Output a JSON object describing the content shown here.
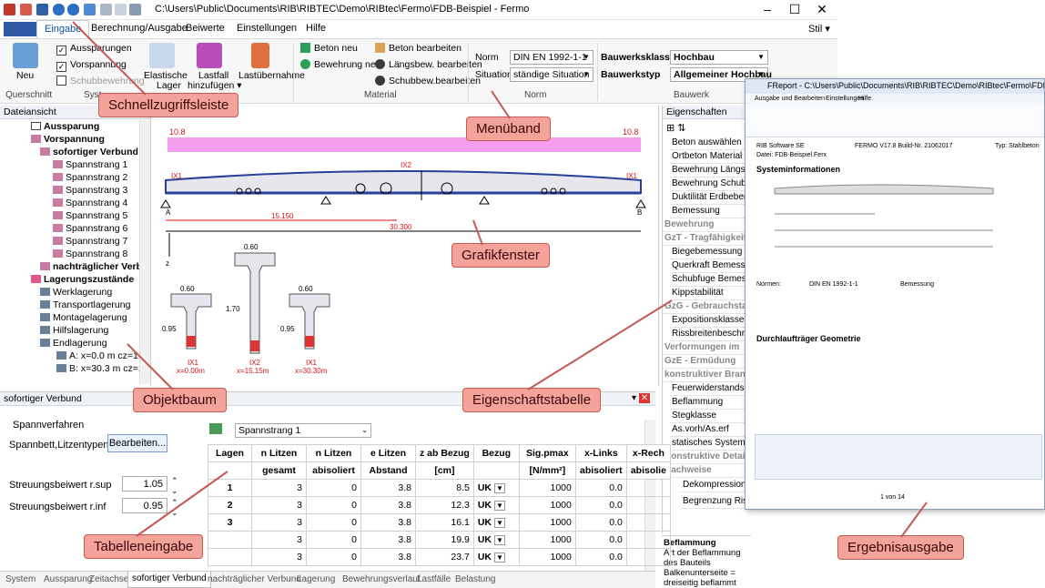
{
  "titlebar": {
    "path": "C:\\Users\\Public\\Documents\\RIB\\RIBTEC\\Demo\\RIBtec\\Fermo\\FDB-Beispiel - Fermo",
    "minimize": "–",
    "maximize": "☐",
    "close": "✕"
  },
  "tabs": {
    "t1": "Eingabe",
    "t2": "Berechnung/Ausgabe",
    "t3": "Beiwerte",
    "t4": "Einstellungen",
    "t5": "Hilfe",
    "style": "Stil ▾"
  },
  "ribbon": {
    "neu": "Neu",
    "aussp": "Aussparungen",
    "vorsp": "Vorspannung",
    "schubbew": "Schubbewehrung",
    "elast": "Elastische",
    "lager": "Lager",
    "lastfall": "Lastfall",
    "hinzu": "hinzufügen ▾",
    "lastuber": "Lastübernahme",
    "betonneu": "Beton neu",
    "bewneu": "Bewehrung neu",
    "betonbe": "Beton bearbeiten",
    "laengs": "Längsbew. bearbeiten",
    "schubbe": "Schubbew.bearbeiten",
    "norm_label": "Norm",
    "norm_value": "DIN EN 1992-1-1",
    "sit_label": "Situation",
    "sit_value": "ständige Situation",
    "bwk_label": "Bauwerksklasse",
    "bwk_value": "Hochbau",
    "bwt_label": "Bauwerkstyp",
    "bwt_value": "Allgemeiner Hochbau",
    "g_querschnitt": "Querschnitt",
    "g_system": "Syst",
    "g_material": "Material",
    "g_norm": "Norm",
    "g_bauwerk": "Bauwerk"
  },
  "tree": {
    "head": "Dateiansicht",
    "items": [
      "Aussparung",
      "Vorspannung",
      "sofortiger Verbund",
      "Spannstrang 1",
      "Spannstrang 2",
      "Spannstrang 3",
      "Spannstrang 4",
      "Spannstrang 5",
      "Spannstrang 6",
      "Spannstrang 7",
      "Spannstrang 8",
      "nachträglicher Verbur",
      "Lagerungszustände",
      "Werklagerung",
      "Transportlagerung",
      "Montagelagerung",
      "Hilfslagerung",
      "Endlagerung",
      "A: x=0.0 m  cz=1.0 r",
      "B: x=30.3 m  cz=1.0"
    ]
  },
  "graphics": {
    "left10": "10.8",
    "right10": "10.8",
    "ix1": "IX1",
    "ix2": "IX2",
    "ix1r": "IX1",
    "a": "A",
    "b": "B",
    "d1": "15.150",
    "d2": "30.300",
    "z": "z",
    "w1": "0.60",
    "w2": "0.60",
    "w3": "0.60",
    "h1": "0.95",
    "h2": "1.70",
    "h3": "0.95",
    "s1a": "IX1",
    "s1b": "x=0.00m",
    "s2a": "IX2",
    "s2b": "x=15.15m",
    "s3a": "IX1",
    "s3b": "x=30.30m"
  },
  "props": {
    "head": "Eigenschaften",
    "rows": [
      "Beton auswählen",
      "Ortbeton Material",
      "Bewehrung Längs & Qu",
      "Bewehrung Schubfuge",
      "Duktilität Erdbeben",
      "Bemessung",
      "Bewehrung",
      "GzT - Tragfähigkeit",
      "Biegebemessung",
      "Querkraft Bemessun",
      "Schubfuge Bemessun",
      "Kippstabilität",
      "GzG - Gebrauchstau",
      "Expositionsklasse",
      "Rissbreitenbeschrän",
      "Verformungen im",
      "GzE - Ermüdung",
      "konstruktiver Brand",
      "Feuerwiderstandsklasse",
      "Beflammung",
      "Stegklasse",
      "As.vorh/As.erf",
      "statisches System",
      "Konstruktive Detail",
      "Nachweise",
      "GzT - Tragfähigkeit",
      "Biegetragfähigke",
      "Schubtragfähigk",
      "Kippstabilität",
      "GzG - Gebrauchstau",
      "Dekompression",
      "Begrenzung Rissbr"
    ],
    "extra": "direkte Berec...",
    "bot_title": "Beflammung",
    "bot_l1": "Art der Beflammung des Bauteils",
    "bot_l2": "Balkenunterseite = dreiseitig beflammt"
  },
  "bottom": {
    "head": "sofortiger Verbund",
    "spv": "Spannverfahren",
    "spb": "Spannbett,Litzentypen",
    "bearb": "Bearbeiten...",
    "rsup": "Streuungsbeiwert r.sup",
    "rsup_v": "1.05",
    "rinf": "Streuungsbeiwert r.inf",
    "rinf_v": "0.95",
    "strang": "Spannstrang 1",
    "cols": [
      "Lagen",
      "n Litzen",
      "n Litzen",
      "e Litzen",
      "z ab Bezug",
      "Bezug",
      "Sig.pmax",
      "x-Links",
      "x-Rech"
    ],
    "sub": [
      "",
      "gesamt",
      "abisoliert",
      "Abstand",
      "[cm]",
      "",
      "[N/mm²]",
      "abisoliert",
      "abisolie"
    ],
    "rows": [
      [
        "1",
        "3",
        "0",
        "3.8",
        "8.5",
        "UK",
        "1000",
        "0.0"
      ],
      [
        "2",
        "3",
        "0",
        "3.8",
        "12.3",
        "UK",
        "1000",
        "0.0"
      ],
      [
        "3",
        "3",
        "0",
        "3.8",
        "16.1",
        "UK",
        "1000",
        "0.0"
      ],
      [
        "",
        "3",
        "0",
        "3.8",
        "19.9",
        "UK",
        "1000",
        "0.0"
      ],
      [
        "",
        "3",
        "0",
        "3.8",
        "23.7",
        "UK",
        "1000",
        "0.0"
      ]
    ]
  },
  "btabs": [
    "System",
    "Aussparung",
    "Zeitachse",
    "sofortiger Verbund",
    "nachträglicher Verbund",
    "Lagerung",
    "Bewehrungsverlauf",
    "Lastfälle",
    "Belastung"
  ],
  "result": {
    "title": "FReport - C:\\Users\\Public\\Documents\\RIB\\RIBTEC\\Demo\\RIBtec\\Fermo\\FDB-Beispiel.frx",
    "t1": "Ausgabe und Bearbeiten",
    "t2": "Einstellungen",
    "t3": "Hilfe",
    "h1": "RIB Software SE",
    "h2": "FERMO V17.8 Build-Nr. 21062017",
    "h3": "Typ: Stahlbeton",
    "h4": "Datei: FDB-Beispiel.Ferx",
    "sys": "Systeminformationen",
    "geo": "Durchlaufträger Geometrie",
    "normen": "Normen:",
    "normv": "DIN EN 1992-1-1",
    "bem": "Bemessung",
    "page": "1 von 14"
  },
  "callouts": {
    "c1": "Schnellzugriffsleiste",
    "c2": "Menüband",
    "c3": "Grafikfenster",
    "c4": "Objektbaum",
    "c5": "Eigenschaftstabelle",
    "c6": "Tabelleneingabe",
    "c7": "Ergebnisausgabe"
  }
}
